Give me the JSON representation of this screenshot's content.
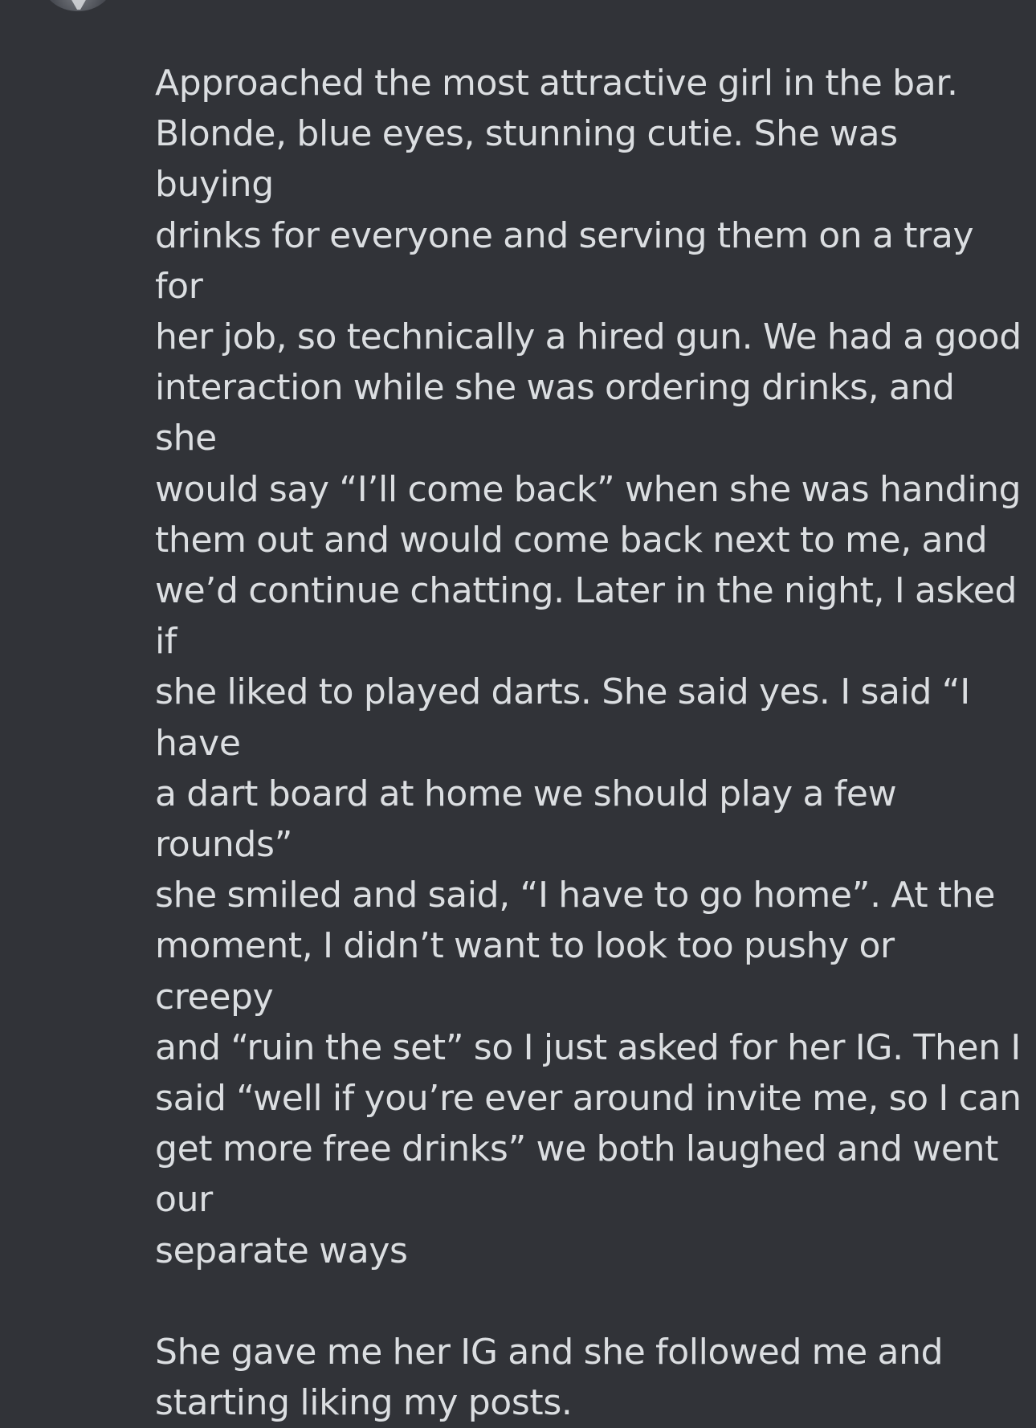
{
  "message": {
    "paragraphs": [
      "Approached the most attractive girl in the bar.\nBlonde, blue eyes, stunning cutie. She was buying\ndrinks for everyone and serving them on a tray for\nher job, so technically a hired gun. We had a good\ninteraction while she was ordering drinks, and she\nwould say “I’ll come back” when she was handing\nthem out and would come back next to me, and\nwe’d continue chatting. Later in the night, I asked if\nshe liked to played darts. She said yes. I said “I have\na dart board at home we should play a few rounds”\nshe smiled and said, “I have to go home”. At the\nmoment, I didn’t want to look too pushy or creepy\nand “ruin the set” so I just asked for her IG. Then I\nsaid “well if you’re ever around invite me, so I can\nget more free drinks” we both laughed and went our\nseparate ways",
      "She gave me her IG and she followed me and\nstarting liking my posts."
    ]
  },
  "colors": {
    "background": "#313338",
    "text": "#dbdee1"
  }
}
